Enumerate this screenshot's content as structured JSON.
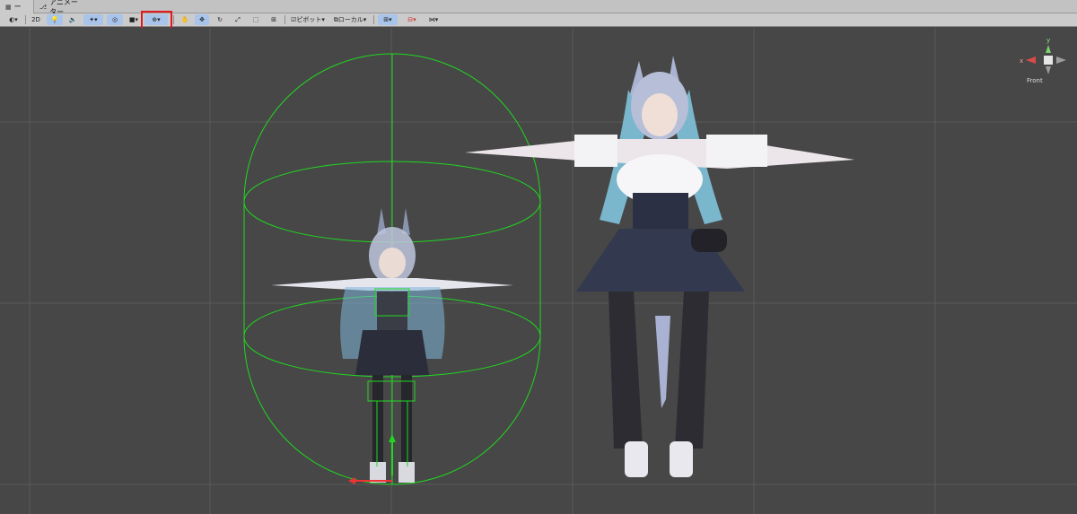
{
  "tabs": [
    {
      "label": "シーン",
      "icon": "grid-icon",
      "active": true
    },
    {
      "label": "アニメーター",
      "icon": "animator-icon",
      "active": false
    }
  ],
  "toolbar": {
    "mode_2d": "2D",
    "pivot_label": "ピボット",
    "local_label": "ローカル"
  },
  "scene": {
    "view_label": "Front",
    "axis_y": "y",
    "axis_x": "x"
  },
  "colors": {
    "background": "#474747",
    "grid": "#5a5a5a",
    "collider": "#1fd81f",
    "highlight": "#e0191f",
    "toolbar": "#cbcbcb",
    "toggle_active": "#a9c4eb"
  }
}
